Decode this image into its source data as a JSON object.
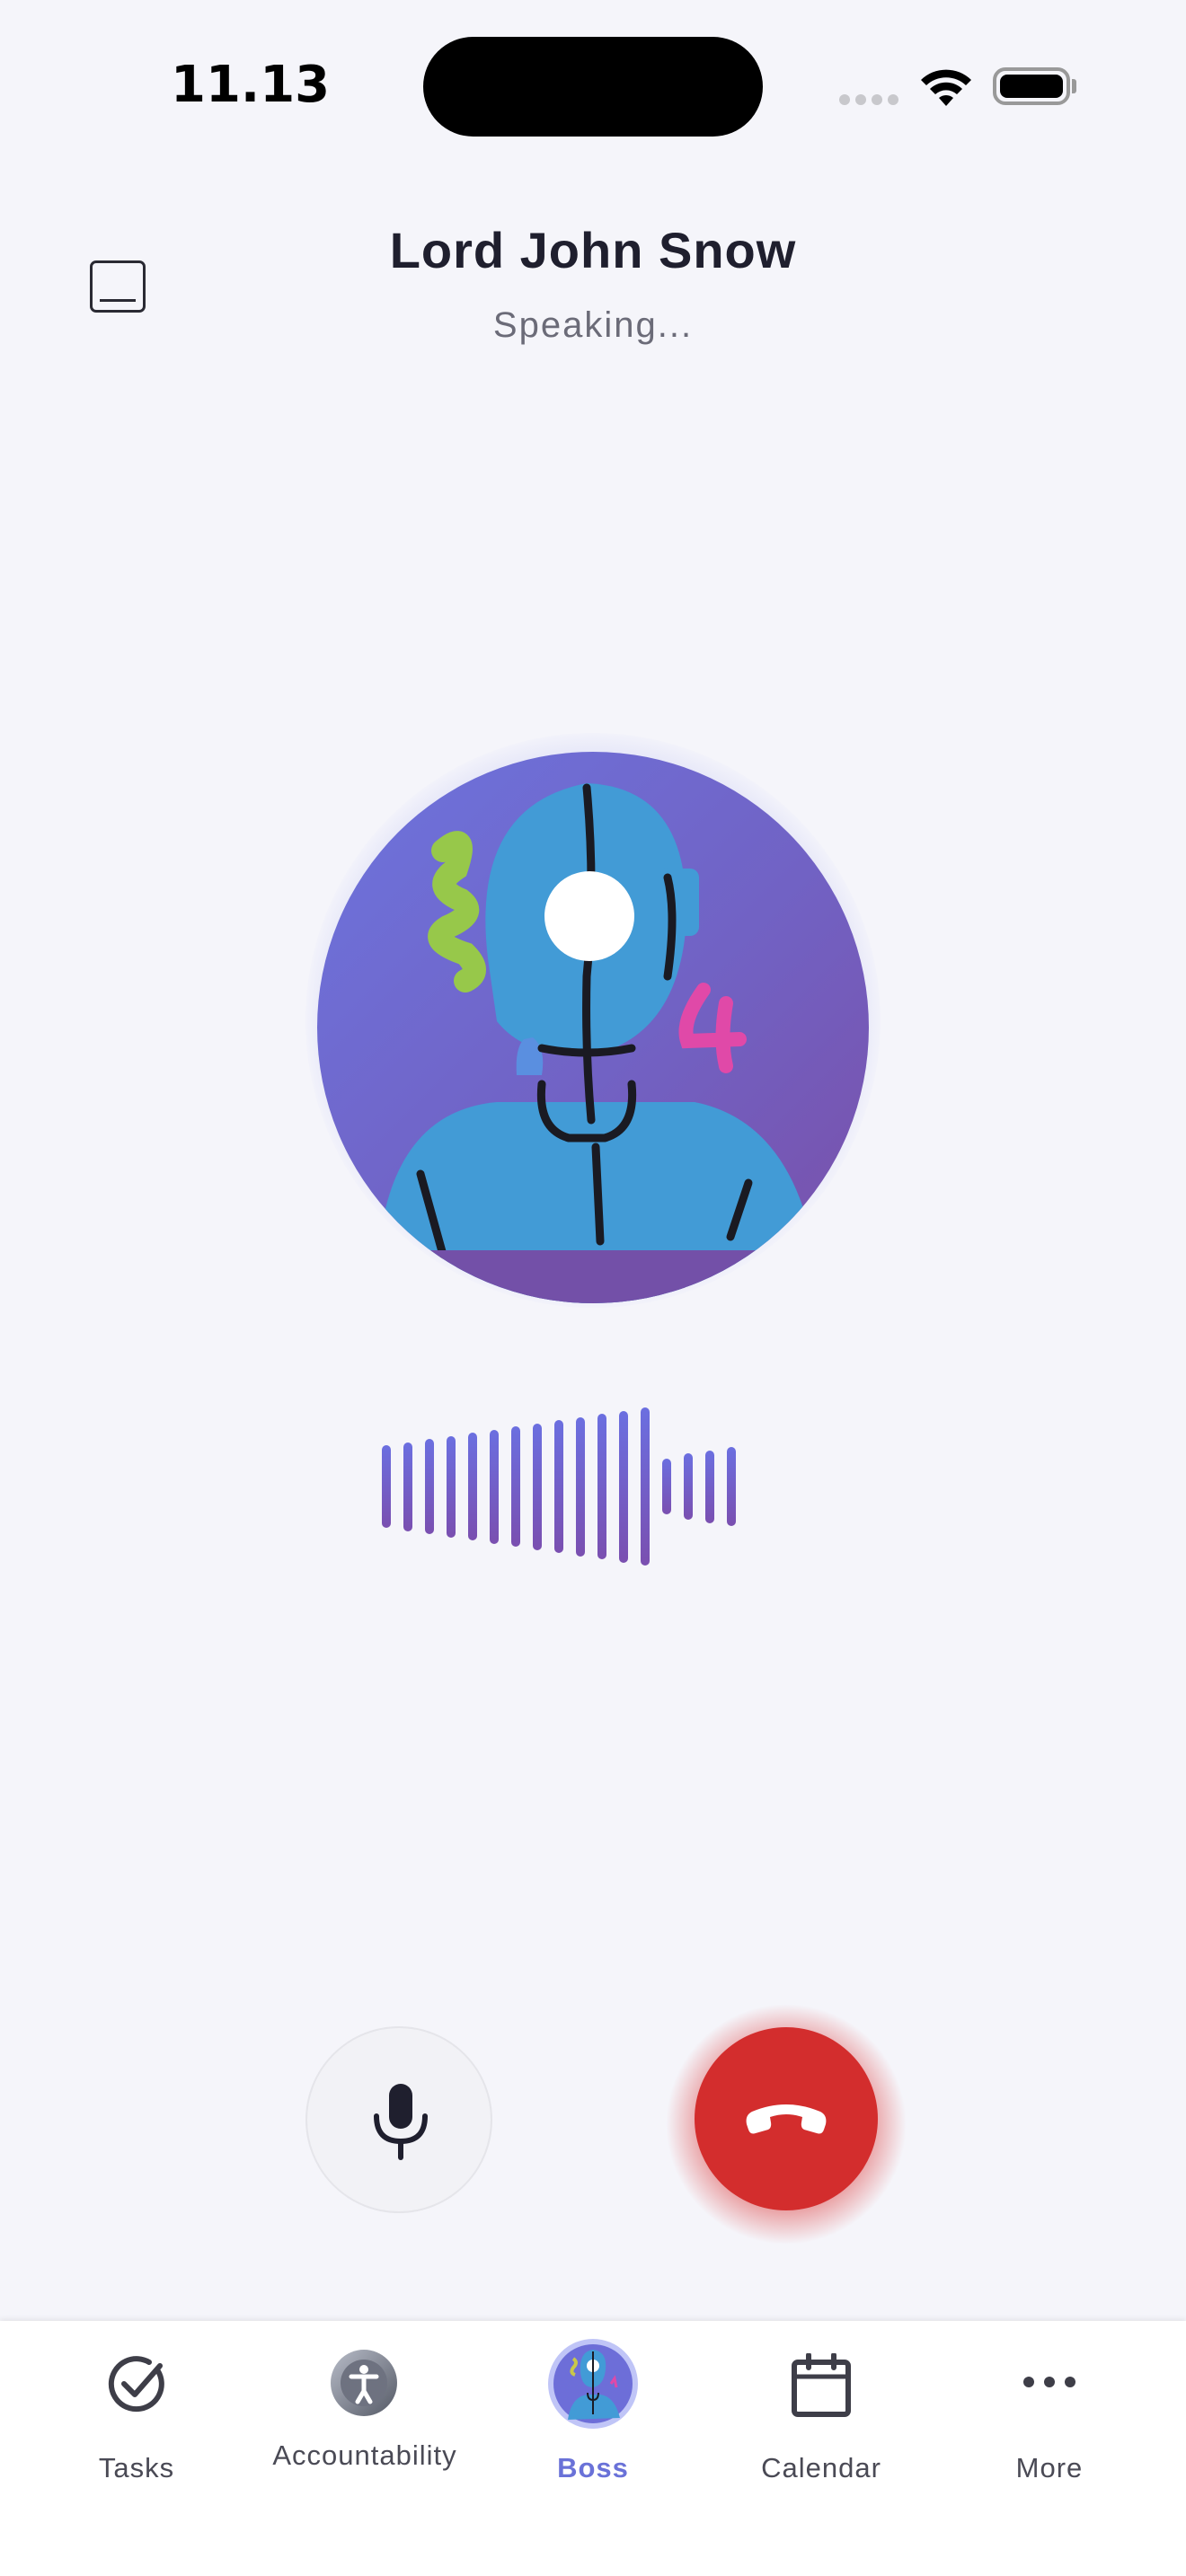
{
  "status_bar": {
    "time": "11.13"
  },
  "header": {
    "caller_name": "Lord John Snow",
    "call_status": "Speaking..."
  },
  "waveform": {
    "levels": [
      0.52,
      0.56,
      0.6,
      0.64,
      0.68,
      0.72,
      0.76,
      0.8,
      0.84,
      0.88,
      0.92,
      0.96,
      1.0,
      0.35,
      0.42,
      0.46,
      0.5
    ]
  },
  "controls": {
    "mic_icon": "microphone-icon",
    "end_call_icon": "phone-hangup-icon"
  },
  "colors": {
    "accent": "#6b6fe0",
    "end_call": "#d32d2d",
    "background": "#f5f5fa",
    "active_tab": "#6a72d8"
  },
  "tabs": [
    {
      "label": "Tasks",
      "icon": "check-circle-icon",
      "active": false
    },
    {
      "label": "Accountability",
      "icon": "accountability-avatar-icon",
      "active": false
    },
    {
      "label": "Boss",
      "icon": "boss-avatar-icon",
      "active": true
    },
    {
      "label": "Calendar",
      "icon": "calendar-icon",
      "active": false
    },
    {
      "label": "More",
      "icon": "more-dots-icon",
      "active": false
    }
  ]
}
